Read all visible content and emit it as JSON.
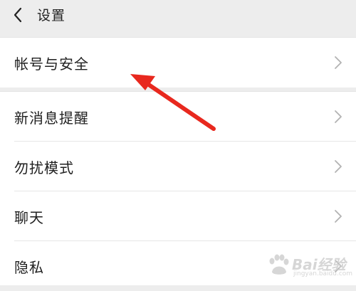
{
  "header": {
    "back_icon": "chevron-left-icon",
    "title": "设置"
  },
  "sections": {
    "account": {
      "label": "帐号与安全"
    },
    "notifications": {
      "label": "新消息提醒"
    },
    "dnd": {
      "label": "勿扰模式"
    },
    "chat": {
      "label": "聊天"
    },
    "privacy": {
      "label": "隐私"
    }
  },
  "icons": {
    "row_chevron": "chevron-right-icon"
  },
  "annotation": {
    "color": "#e8281e"
  },
  "watermark": {
    "brand": "Bai经验",
    "domain": "jingyan.baidu.com"
  }
}
